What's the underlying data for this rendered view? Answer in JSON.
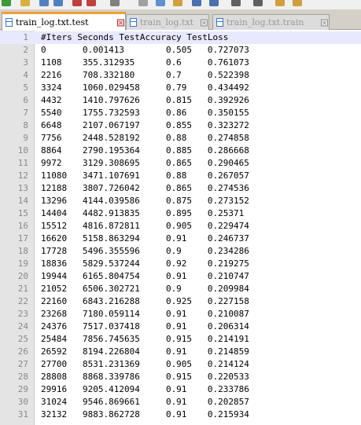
{
  "toolbar": {
    "icons": [
      "new-file-icon",
      "open-file-icon",
      "save-icon",
      "save-all-icon",
      "close-icon",
      "close-all-icon",
      "print-icon",
      "cut-icon",
      "copy-icon",
      "paste-icon",
      "undo-icon",
      "redo-icon",
      "find-icon",
      "replace-icon",
      "zoom-in-icon",
      "zoom-out-icon"
    ]
  },
  "tabs": [
    {
      "label": "train_log.txt.test",
      "active": true
    },
    {
      "label": "train_log.txt",
      "active": false
    },
    {
      "label": "train_log.txt.train",
      "active": false
    }
  ],
  "editor": {
    "lines": [
      {
        "num": "1",
        "text": "#Iters Seconds TestAccuracy TestLoss"
      },
      {
        "num": "2",
        "text": "0       0.001413        0.505   0.727073"
      },
      {
        "num": "3",
        "text": "1108    355.312935      0.6     0.761073"
      },
      {
        "num": "4",
        "text": "2216    708.332180      0.7     0.522398"
      },
      {
        "num": "5",
        "text": "3324    1060.029458     0.79    0.434492"
      },
      {
        "num": "6",
        "text": "4432    1410.797626     0.815   0.392926"
      },
      {
        "num": "7",
        "text": "5540    1755.732593     0.86    0.350155"
      },
      {
        "num": "8",
        "text": "6648    2107.067197     0.855   0.323272"
      },
      {
        "num": "9",
        "text": "7756    2448.528192     0.88    0.274858"
      },
      {
        "num": "10",
        "text": "8864    2790.195364     0.885   0.286668"
      },
      {
        "num": "11",
        "text": "9972    3129.308695     0.865   0.290465"
      },
      {
        "num": "12",
        "text": "11080   3471.107691     0.88    0.267057"
      },
      {
        "num": "13",
        "text": "12188   3807.726042     0.865   0.274536"
      },
      {
        "num": "14",
        "text": "13296   4144.039586     0.875   0.273152"
      },
      {
        "num": "15",
        "text": "14404   4482.913835     0.895   0.25371"
      },
      {
        "num": "16",
        "text": "15512   4816.872811     0.905   0.229474"
      },
      {
        "num": "17",
        "text": "16620   5158.863294     0.91    0.246737"
      },
      {
        "num": "18",
        "text": "17728   5496.355596     0.9     0.234286"
      },
      {
        "num": "19",
        "text": "18836   5829.537244     0.92    0.219275"
      },
      {
        "num": "20",
        "text": "19944   6165.804754     0.91    0.210747"
      },
      {
        "num": "21",
        "text": "21052   6506.302721     0.9     0.209984"
      },
      {
        "num": "22",
        "text": "22160   6843.216288     0.925   0.227158"
      },
      {
        "num": "23",
        "text": "23268   7180.059114     0.91    0.210087"
      },
      {
        "num": "24",
        "text": "24376   7517.037418     0.91    0.206314"
      },
      {
        "num": "25",
        "text": "25484   7856.745635     0.915   0.214191"
      },
      {
        "num": "26",
        "text": "26592   8194.226804     0.91    0.214859"
      },
      {
        "num": "27",
        "text": "27700   8531.231369     0.905   0.214124"
      },
      {
        "num": "28",
        "text": "28808   8868.339786     0.915   0.220533"
      },
      {
        "num": "29",
        "text": "29916   9205.412094     0.91    0.233786"
      },
      {
        "num": "30",
        "text": "31024   9546.869661     0.91    0.202857"
      },
      {
        "num": "31",
        "text": "32132   9883.862728     0.91    0.215934"
      }
    ]
  },
  "colors": {
    "active_tab_accent": "#f0a030",
    "gutter_background": "#e4e4e4",
    "current_line_highlight": "#e8e8ff"
  }
}
